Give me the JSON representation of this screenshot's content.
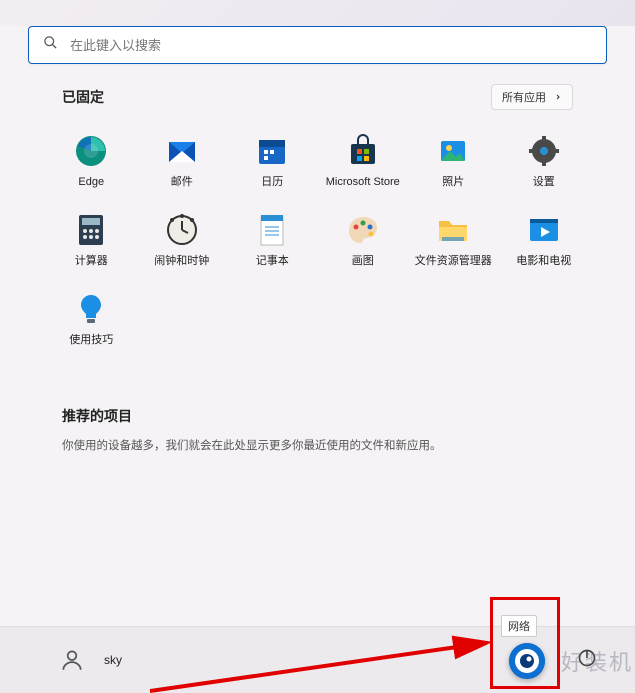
{
  "search": {
    "placeholder": "在此键入以搜索"
  },
  "pinned": {
    "title": "已固定",
    "all_apps": "所有应用",
    "items": [
      {
        "label": "Edge",
        "icon": "edge"
      },
      {
        "label": "邮件",
        "icon": "mail"
      },
      {
        "label": "日历",
        "icon": "calendar"
      },
      {
        "label": "Microsoft Store",
        "icon": "store"
      },
      {
        "label": "照片",
        "icon": "photos"
      },
      {
        "label": "设置",
        "icon": "settings"
      },
      {
        "label": "计算器",
        "icon": "calculator"
      },
      {
        "label": "闹钟和时钟",
        "icon": "clock"
      },
      {
        "label": "记事本",
        "icon": "notepad"
      },
      {
        "label": "画图",
        "icon": "paint"
      },
      {
        "label": "文件资源管理器",
        "icon": "explorer"
      },
      {
        "label": "电影和电视",
        "icon": "movies"
      },
      {
        "label": "使用技巧",
        "icon": "tips"
      }
    ]
  },
  "recommended": {
    "title": "推荐的项目",
    "text": "你使用的设备越多，我们就会在此处显示更多你最近使用的文件和新应用。"
  },
  "user": {
    "name": "sky"
  },
  "tooltip": "网络",
  "watermark": "好装机"
}
